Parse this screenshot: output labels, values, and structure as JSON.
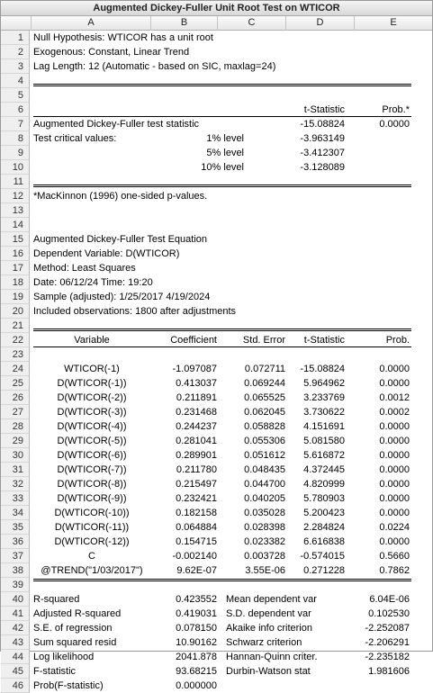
{
  "window": {
    "title": "Augmented Dickey-Fuller Unit Root Test on WTICOR"
  },
  "columns": [
    "A",
    "B",
    "C",
    "D",
    "E"
  ],
  "header": {
    "r1": "Null Hypothesis: WTICOR has a unit root",
    "r2": "Exogenous: Constant, Linear Trend",
    "r3": "Lag Length: 12 (Automatic - based on SIC, maxlag=24)"
  },
  "adf": {
    "col_tstat": "t-Statistic",
    "col_prob": "Prob.*",
    "stat_label": "Augmented Dickey-Fuller test statistic",
    "stat_value": "-15.08824",
    "stat_prob": "0.0000",
    "crit_label": "Test critical values:",
    "crit": [
      {
        "level": "1% level",
        "value": "-3.963149"
      },
      {
        "level": "5% level",
        "value": "-3.412307"
      },
      {
        "level": "10% level",
        "value": "-3.128089"
      }
    ],
    "footnote": "*MacKinnon (1996) one-sided p-values."
  },
  "equation": {
    "r16": "Augmented Dickey-Fuller Test Equation",
    "r17": "Dependent Variable: D(WTICOR)",
    "r18": "Method: Least Squares",
    "r19": "Date: 06/12/24   Time: 19:20",
    "r20": "Sample (adjusted): 1/25/2017 4/19/2024",
    "r21": "Included observations: 1800 after adjustments"
  },
  "coef_table": {
    "headers": [
      "Variable",
      "Coefficient",
      "Std. Error",
      "t-Statistic",
      "Prob."
    ],
    "rows": [
      [
        "WTICOR(-1)",
        "-1.097087",
        "0.072711",
        "-15.08824",
        "0.0000"
      ],
      [
        "D(WTICOR(-1))",
        "0.413037",
        "0.069244",
        "5.964962",
        "0.0000"
      ],
      [
        "D(WTICOR(-2))",
        "0.211891",
        "0.065525",
        "3.233769",
        "0.0012"
      ],
      [
        "D(WTICOR(-3))",
        "0.231468",
        "0.062045",
        "3.730622",
        "0.0002"
      ],
      [
        "D(WTICOR(-4))",
        "0.244237",
        "0.058828",
        "4.151691",
        "0.0000"
      ],
      [
        "D(WTICOR(-5))",
        "0.281041",
        "0.055306",
        "5.081580",
        "0.0000"
      ],
      [
        "D(WTICOR(-6))",
        "0.289901",
        "0.051612",
        "5.616872",
        "0.0000"
      ],
      [
        "D(WTICOR(-7))",
        "0.211780",
        "0.048435",
        "4.372445",
        "0.0000"
      ],
      [
        "D(WTICOR(-8))",
        "0.215497",
        "0.044700",
        "4.820999",
        "0.0000"
      ],
      [
        "D(WTICOR(-9))",
        "0.232421",
        "0.040205",
        "5.780903",
        "0.0000"
      ],
      [
        "D(WTICOR(-10))",
        "0.182158",
        "0.035028",
        "5.200423",
        "0.0000"
      ],
      [
        "D(WTICOR(-11))",
        "0.064884",
        "0.028398",
        "2.284824",
        "0.0224"
      ],
      [
        "D(WTICOR(-12))",
        "0.154715",
        "0.023382",
        "6.616838",
        "0.0000"
      ],
      [
        "C",
        "-0.002140",
        "0.003728",
        "-0.574015",
        "0.5660"
      ],
      [
        "@TREND(\"1/03/2017\")",
        "9.62E-07",
        "3.55E-06",
        "0.271228",
        "0.7862"
      ]
    ]
  },
  "summary": [
    [
      "R-squared",
      "0.423552",
      "Mean dependent var",
      "6.04E-06"
    ],
    [
      "Adjusted R-squared",
      "0.419031",
      "S.D. dependent var",
      "0.102530"
    ],
    [
      "S.E. of regression",
      "0.078150",
      "Akaike info criterion",
      "-2.252087"
    ],
    [
      "Sum squared resid",
      "10.90162",
      "Schwarz criterion",
      "-2.206291"
    ],
    [
      "Log likelihood",
      "2041.878",
      "Hannan-Quinn criter.",
      "-2.235182"
    ],
    [
      "F-statistic",
      "93.68215",
      "Durbin-Watson stat",
      "1.981606"
    ],
    [
      "Prob(F-statistic)",
      "0.000000",
      "",
      ""
    ]
  ]
}
